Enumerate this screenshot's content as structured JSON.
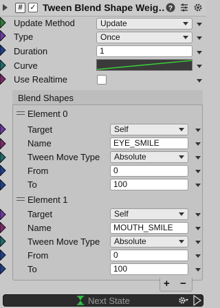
{
  "header": {
    "icon_glyph": "#",
    "enabled_check": "✓",
    "title": "Tween Blend Shape Weig…",
    "help_icon": "help-icon",
    "settings_icon": "sliders-icon",
    "menu_icon": "gear-icon"
  },
  "fields": {
    "update_method": {
      "label": "Update Method",
      "value": "Update"
    },
    "type": {
      "label": "Type",
      "value": "Once"
    },
    "duration": {
      "label": "Duration",
      "value": "1"
    },
    "curve": {
      "label": "Curve"
    },
    "use_realtime": {
      "label": "Use Realtime",
      "checked": false
    }
  },
  "blend_shapes": {
    "title": "Blend Shapes",
    "elements": [
      {
        "title": "Element 0",
        "target": {
          "label": "Target",
          "value": "Self"
        },
        "name": {
          "label": "Name",
          "value": "EYE_SMILE"
        },
        "tween_move_type": {
          "label": "Tween Move Type",
          "value": "Absolute"
        },
        "from": {
          "label": "From",
          "value": "0"
        },
        "to": {
          "label": "To",
          "value": "100"
        }
      },
      {
        "title": "Element 1",
        "target": {
          "label": "Target",
          "value": "Self"
        },
        "name": {
          "label": "Name",
          "value": "MOUTH_SMILE"
        },
        "tween_move_type": {
          "label": "Tween Move Type",
          "value": "Absolute"
        },
        "from": {
          "label": "From",
          "value": "0"
        },
        "to": {
          "label": "To",
          "value": "100"
        }
      }
    ],
    "add_label": "+",
    "remove_label": "−"
  },
  "next_state": {
    "label": "Next State"
  },
  "colors": {
    "curve_line": "#3ad23a",
    "port_colors": [
      "#2e7a3a",
      "#6a3aa0",
      "#1f3f8a",
      "#7a2a6a",
      "#1f6a6a"
    ]
  }
}
